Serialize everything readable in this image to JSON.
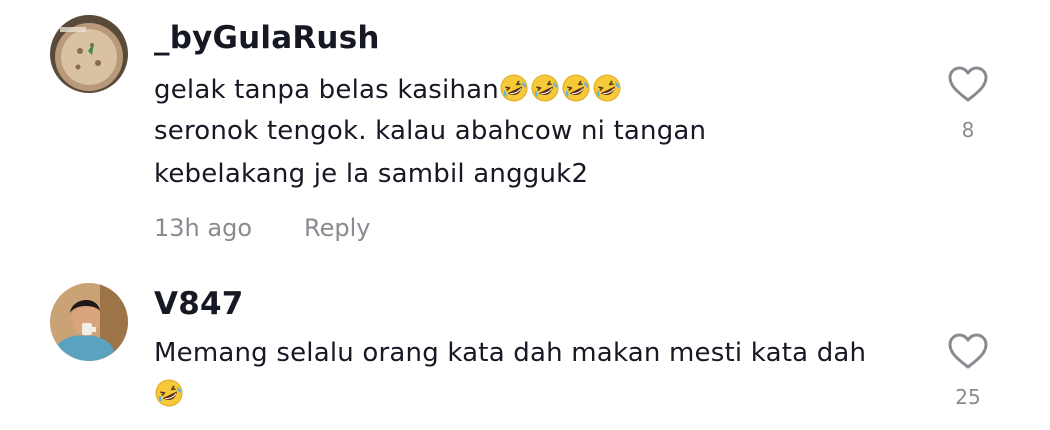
{
  "comments": [
    {
      "username": "_byGulaRush",
      "avatar": "food-pizza-avatar",
      "lines": [
        {
          "text": "gelak tanpa belas kasihan",
          "emoji_count": 4,
          "emoji": "rolling-on-floor-laughing"
        },
        {
          "text": "seronok tengok. kalau abahcow ni tangan"
        },
        {
          "text": "kebelakang je la sambil angguk2"
        }
      ],
      "time": "13h ago",
      "reply_label": "Reply",
      "likes": "8"
    },
    {
      "username": "V847",
      "avatar": "person-photo-avatar",
      "lines": [
        {
          "text": "Memang selalu orang kata dah makan mesti kata dah"
        },
        {
          "text": "",
          "emoji_count": 1,
          "emoji": "rolling-on-floor-laughing"
        }
      ],
      "likes": "25"
    }
  ],
  "colors": {
    "text": "#161823",
    "secondary": "#8a8b91",
    "background": "#ffffff"
  }
}
